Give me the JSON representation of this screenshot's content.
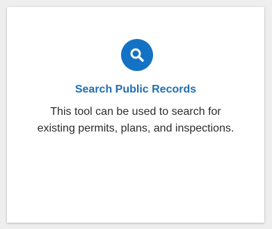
{
  "card": {
    "icon": "search-icon",
    "icon_bg_color": "#1472c4",
    "title": "Search Public Records",
    "title_color": "#1f6fb3",
    "description": "This tool can be used to search for existing permits, plans, and inspections."
  }
}
